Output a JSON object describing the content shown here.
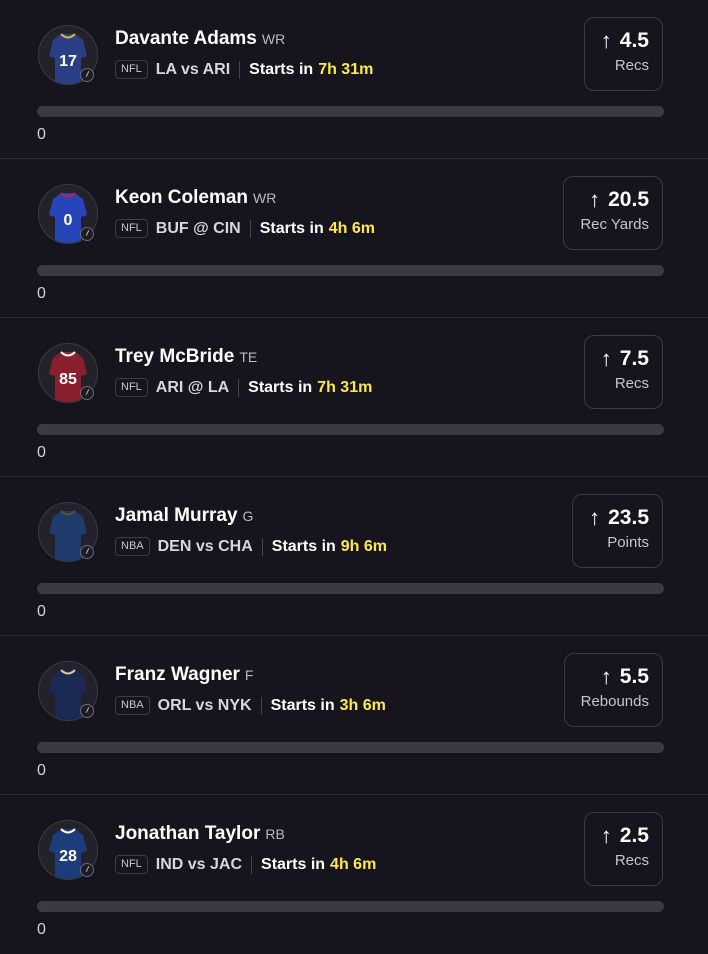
{
  "players": [
    {
      "name": "Davante Adams",
      "position": "WR",
      "league": "NFL",
      "matchup": "LA vs ARI",
      "starts_label": "Starts in",
      "time": "7h 31m",
      "line": "4.5",
      "stat": "Recs",
      "direction_icon": "arrow-up-icon",
      "progress": 0,
      "count": "0",
      "jersey": {
        "number": "17",
        "color": "#2b3f86",
        "accent": "#d4b53a"
      }
    },
    {
      "name": "Keon Coleman",
      "position": "WR",
      "league": "NFL",
      "matchup": "BUF @ CIN",
      "starts_label": "Starts in",
      "time": "4h 6m",
      "line": "20.5",
      "stat": "Rec Yards",
      "direction_icon": "arrow-up-icon",
      "progress": 0,
      "count": "0",
      "jersey": {
        "number": "0",
        "color": "#2545b8",
        "accent": "#c8203a"
      }
    },
    {
      "name": "Trey McBride",
      "position": "TE",
      "league": "NFL",
      "matchup": "ARI @ LA",
      "starts_label": "Starts in",
      "time": "7h 31m",
      "line": "7.5",
      "stat": "Recs",
      "direction_icon": "arrow-up-icon",
      "progress": 0,
      "count": "0",
      "jersey": {
        "number": "85",
        "color": "#8a1f2e",
        "accent": "#ffffff"
      }
    },
    {
      "name": "Jamal Murray",
      "position": "G",
      "league": "NBA",
      "matchup": "DEN vs CHA",
      "starts_label": "Starts in",
      "time": "9h 6m",
      "line": "23.5",
      "stat": "Points",
      "direction_icon": "arrow-up-icon",
      "progress": 0,
      "count": "0",
      "jersey": {
        "number": "",
        "color": "#1f3b6b",
        "accent": "#6b4a36"
      }
    },
    {
      "name": "Franz Wagner",
      "position": "F",
      "league": "NBA",
      "matchup": "ORL vs NYK",
      "starts_label": "Starts in",
      "time": "3h 6m",
      "line": "5.5",
      "stat": "Rebounds",
      "direction_icon": "arrow-up-icon",
      "progress": 0,
      "count": "0",
      "jersey": {
        "number": "",
        "color": "#1b2a55",
        "accent": "#e6c4a8"
      }
    },
    {
      "name": "Jonathan Taylor",
      "position": "RB",
      "league": "NFL",
      "matchup": "IND vs JAC",
      "starts_label": "Starts in",
      "time": "4h 6m",
      "line": "2.5",
      "stat": "Recs",
      "direction_icon": "arrow-up-icon",
      "progress": 0,
      "count": "0",
      "jersey": {
        "number": "28",
        "color": "#1c3d7a",
        "accent": "#ffffff"
      }
    }
  ]
}
